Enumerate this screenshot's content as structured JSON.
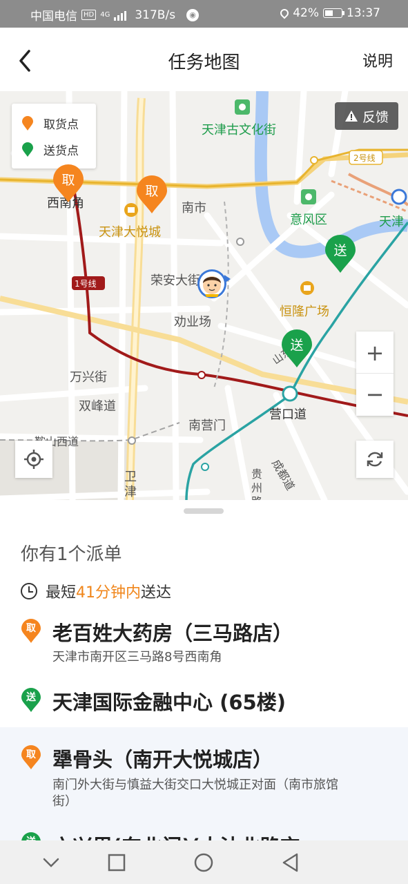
{
  "status_bar": {
    "carrier": "中国电信",
    "hd": "HD",
    "net": "4G",
    "speed": "317B/s",
    "battery": "42%",
    "time": "13:37"
  },
  "header": {
    "title": "任务地图",
    "help_label": "说明"
  },
  "map": {
    "legend": {
      "pickup": "取货点",
      "delivery": "送货点"
    },
    "feedback_label": "反馈",
    "labels": {
      "culture_street": "天津古文化街",
      "line2": "2号线",
      "xinanjiao": "西南角",
      "joy_city": "天津大悦城",
      "nanshi": "南市",
      "yifeng": "意风区",
      "tianjin": "天津",
      "rongan": "荣安大街",
      "line1": "1号线",
      "henglong": "恒隆广场",
      "quanye": "劝业场",
      "wanxing": "万兴街",
      "shuangfeng": "双峰道",
      "yingkou": "营口道",
      "anshan": "鞍山西道",
      "nanyingmen": "南营门",
      "weijin": "卫津",
      "guizhou": "贵州路",
      "chengdu": "成都道",
      "shandong": "山东路"
    },
    "markers": {
      "pickup_text": "取",
      "delivery_text": "送"
    },
    "zoom_in": "+",
    "zoom_out": "−"
  },
  "sheet": {
    "order_count": "你有1个派单",
    "eta_prefix": "最短",
    "eta_highlight": "41分钟内",
    "eta_suffix": "送达",
    "orders": [
      {
        "pickup_badge": "取",
        "pickup_name": "老百姓大药房（三马路店）",
        "pickup_address": "天津市南开区三马路8号西南角",
        "delivery_badge": "送",
        "delivery_name": "天津国际金融中心 (65楼)"
      },
      {
        "pickup_badge": "取",
        "pickup_name": "犟骨头（南开大悦城店）",
        "pickup_address": "南门外大街与慎益大街交口大悦城正对面（南市旅馆街）",
        "delivery_badge": "送",
        "delivery_name": "六兴里(东北门)(大沽北路交"
      }
    ]
  },
  "colors": {
    "pickup": "#f5851f",
    "delivery": "#1aa14b",
    "highlight": "#f0861b",
    "status_bar": "#8c8c8c"
  }
}
